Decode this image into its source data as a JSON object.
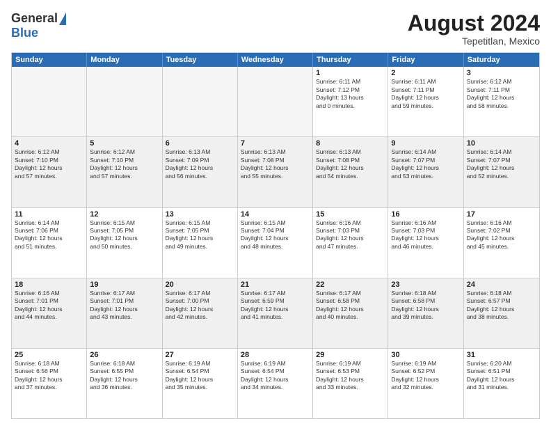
{
  "logo": {
    "general": "General",
    "blue": "Blue"
  },
  "title": "August 2024",
  "subtitle": "Tepetitlan, Mexico",
  "days": [
    "Sunday",
    "Monday",
    "Tuesday",
    "Wednesday",
    "Thursday",
    "Friday",
    "Saturday"
  ],
  "weeks": [
    [
      {
        "num": "",
        "info": ""
      },
      {
        "num": "",
        "info": ""
      },
      {
        "num": "",
        "info": ""
      },
      {
        "num": "",
        "info": ""
      },
      {
        "num": "1",
        "info": "Sunrise: 6:11 AM\nSunset: 7:12 PM\nDaylight: 13 hours\nand 0 minutes."
      },
      {
        "num": "2",
        "info": "Sunrise: 6:11 AM\nSunset: 7:11 PM\nDaylight: 12 hours\nand 59 minutes."
      },
      {
        "num": "3",
        "info": "Sunrise: 6:12 AM\nSunset: 7:11 PM\nDaylight: 12 hours\nand 58 minutes."
      }
    ],
    [
      {
        "num": "4",
        "info": "Sunrise: 6:12 AM\nSunset: 7:10 PM\nDaylight: 12 hours\nand 57 minutes."
      },
      {
        "num": "5",
        "info": "Sunrise: 6:12 AM\nSunset: 7:10 PM\nDaylight: 12 hours\nand 57 minutes."
      },
      {
        "num": "6",
        "info": "Sunrise: 6:13 AM\nSunset: 7:09 PM\nDaylight: 12 hours\nand 56 minutes."
      },
      {
        "num": "7",
        "info": "Sunrise: 6:13 AM\nSunset: 7:08 PM\nDaylight: 12 hours\nand 55 minutes."
      },
      {
        "num": "8",
        "info": "Sunrise: 6:13 AM\nSunset: 7:08 PM\nDaylight: 12 hours\nand 54 minutes."
      },
      {
        "num": "9",
        "info": "Sunrise: 6:14 AM\nSunset: 7:07 PM\nDaylight: 12 hours\nand 53 minutes."
      },
      {
        "num": "10",
        "info": "Sunrise: 6:14 AM\nSunset: 7:07 PM\nDaylight: 12 hours\nand 52 minutes."
      }
    ],
    [
      {
        "num": "11",
        "info": "Sunrise: 6:14 AM\nSunset: 7:06 PM\nDaylight: 12 hours\nand 51 minutes."
      },
      {
        "num": "12",
        "info": "Sunrise: 6:15 AM\nSunset: 7:05 PM\nDaylight: 12 hours\nand 50 minutes."
      },
      {
        "num": "13",
        "info": "Sunrise: 6:15 AM\nSunset: 7:05 PM\nDaylight: 12 hours\nand 49 minutes."
      },
      {
        "num": "14",
        "info": "Sunrise: 6:15 AM\nSunset: 7:04 PM\nDaylight: 12 hours\nand 48 minutes."
      },
      {
        "num": "15",
        "info": "Sunrise: 6:16 AM\nSunset: 7:03 PM\nDaylight: 12 hours\nand 47 minutes."
      },
      {
        "num": "16",
        "info": "Sunrise: 6:16 AM\nSunset: 7:03 PM\nDaylight: 12 hours\nand 46 minutes."
      },
      {
        "num": "17",
        "info": "Sunrise: 6:16 AM\nSunset: 7:02 PM\nDaylight: 12 hours\nand 45 minutes."
      }
    ],
    [
      {
        "num": "18",
        "info": "Sunrise: 6:16 AM\nSunset: 7:01 PM\nDaylight: 12 hours\nand 44 minutes."
      },
      {
        "num": "19",
        "info": "Sunrise: 6:17 AM\nSunset: 7:01 PM\nDaylight: 12 hours\nand 43 minutes."
      },
      {
        "num": "20",
        "info": "Sunrise: 6:17 AM\nSunset: 7:00 PM\nDaylight: 12 hours\nand 42 minutes."
      },
      {
        "num": "21",
        "info": "Sunrise: 6:17 AM\nSunset: 6:59 PM\nDaylight: 12 hours\nand 41 minutes."
      },
      {
        "num": "22",
        "info": "Sunrise: 6:17 AM\nSunset: 6:58 PM\nDaylight: 12 hours\nand 40 minutes."
      },
      {
        "num": "23",
        "info": "Sunrise: 6:18 AM\nSunset: 6:58 PM\nDaylight: 12 hours\nand 39 minutes."
      },
      {
        "num": "24",
        "info": "Sunrise: 6:18 AM\nSunset: 6:57 PM\nDaylight: 12 hours\nand 38 minutes."
      }
    ],
    [
      {
        "num": "25",
        "info": "Sunrise: 6:18 AM\nSunset: 6:56 PM\nDaylight: 12 hours\nand 37 minutes."
      },
      {
        "num": "26",
        "info": "Sunrise: 6:18 AM\nSunset: 6:55 PM\nDaylight: 12 hours\nand 36 minutes."
      },
      {
        "num": "27",
        "info": "Sunrise: 6:19 AM\nSunset: 6:54 PM\nDaylight: 12 hours\nand 35 minutes."
      },
      {
        "num": "28",
        "info": "Sunrise: 6:19 AM\nSunset: 6:54 PM\nDaylight: 12 hours\nand 34 minutes."
      },
      {
        "num": "29",
        "info": "Sunrise: 6:19 AM\nSunset: 6:53 PM\nDaylight: 12 hours\nand 33 minutes."
      },
      {
        "num": "30",
        "info": "Sunrise: 6:19 AM\nSunset: 6:52 PM\nDaylight: 12 hours\nand 32 minutes."
      },
      {
        "num": "31",
        "info": "Sunrise: 6:20 AM\nSunset: 6:51 PM\nDaylight: 12 hours\nand 31 minutes."
      }
    ]
  ]
}
